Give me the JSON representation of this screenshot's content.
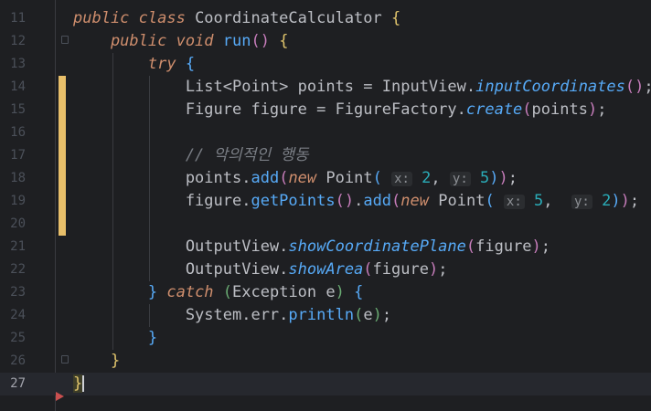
{
  "editor": {
    "lines": [
      {
        "n": "11",
        "parts": [
          [
            "kwi",
            "public class "
          ],
          [
            "cls",
            "CoordinateCalculator "
          ],
          [
            "brace-y",
            "{"
          ]
        ]
      },
      {
        "n": "12",
        "parts": [
          [
            "kwi",
            "    public void "
          ],
          [
            "mth",
            "run"
          ],
          [
            "paren-p",
            "() "
          ],
          [
            "brace-y",
            "{"
          ]
        ]
      },
      {
        "n": "13",
        "parts": [
          [
            "kwi",
            "        try "
          ],
          [
            "paren-b",
            "{"
          ]
        ]
      },
      {
        "n": "14",
        "parts": [
          [
            "cls",
            "            List<Point> points = InputView."
          ],
          [
            "fn-st",
            "inputCoordinates"
          ],
          [
            "paren-p",
            "()"
          ],
          [
            "cls",
            ";"
          ]
        ]
      },
      {
        "n": "15",
        "parts": [
          [
            "cls",
            "            Figure figure = FigureFactory."
          ],
          [
            "fn-st",
            "create"
          ],
          [
            "paren-p",
            "("
          ],
          [
            "cls",
            "points"
          ],
          [
            "paren-p",
            ")"
          ],
          [
            "cls",
            ";"
          ]
        ]
      },
      {
        "n": "16",
        "parts": []
      },
      {
        "n": "17",
        "parts": [
          [
            "cmt",
            "            // 악의적인 행동"
          ]
        ]
      },
      {
        "n": "18",
        "parts": [
          [
            "cls",
            "            points."
          ],
          [
            "mth",
            "add"
          ],
          [
            "paren-p",
            "("
          ],
          [
            "kwi",
            "new "
          ],
          [
            "cls",
            "Point"
          ],
          [
            "paren-b",
            "( "
          ],
          [
            "hint",
            "x:"
          ],
          [
            "cls",
            " "
          ],
          [
            "num",
            "2"
          ],
          [
            "cls",
            ", "
          ],
          [
            "hint",
            "y:"
          ],
          [
            "cls",
            " "
          ],
          [
            "num",
            "5"
          ],
          [
            "paren-b",
            ")"
          ],
          [
            "paren-p",
            ")"
          ],
          [
            "cls",
            ";"
          ]
        ]
      },
      {
        "n": "19",
        "parts": [
          [
            "cls",
            "            figure."
          ],
          [
            "mth",
            "getPoints"
          ],
          [
            "paren-p",
            "()"
          ],
          [
            "cls",
            "."
          ],
          [
            "mth",
            "add"
          ],
          [
            "paren-p",
            "("
          ],
          [
            "kwi",
            "new "
          ],
          [
            "cls",
            "Point"
          ],
          [
            "paren-b",
            "( "
          ],
          [
            "hint",
            "x:"
          ],
          [
            "cls",
            " "
          ],
          [
            "num",
            "5"
          ],
          [
            "cls",
            ",  "
          ],
          [
            "hint",
            "y:"
          ],
          [
            "cls",
            " "
          ],
          [
            "num",
            "2"
          ],
          [
            "paren-b",
            ")"
          ],
          [
            "paren-p",
            ")"
          ],
          [
            "cls",
            ";"
          ]
        ]
      },
      {
        "n": "20",
        "parts": []
      },
      {
        "n": "21",
        "parts": [
          [
            "cls",
            "            OutputView."
          ],
          [
            "fn-st",
            "showCoordinatePlane"
          ],
          [
            "paren-p",
            "("
          ],
          [
            "cls",
            "figure"
          ],
          [
            "paren-p",
            ")"
          ],
          [
            "cls",
            ";"
          ]
        ]
      },
      {
        "n": "22",
        "parts": [
          [
            "cls",
            "            OutputView."
          ],
          [
            "fn-st",
            "showArea"
          ],
          [
            "paren-p",
            "("
          ],
          [
            "cls",
            "figure"
          ],
          [
            "paren-p",
            ")"
          ],
          [
            "cls",
            ";"
          ]
        ]
      },
      {
        "n": "23",
        "parts": [
          [
            "paren-b",
            "        } "
          ],
          [
            "kwi",
            "catch "
          ],
          [
            "paren-g",
            "("
          ],
          [
            "cls",
            "Exception e"
          ],
          [
            "paren-g",
            ") "
          ],
          [
            "paren-b",
            "{"
          ]
        ]
      },
      {
        "n": "24",
        "parts": [
          [
            "cls",
            "            System.err."
          ],
          [
            "mth",
            "println"
          ],
          [
            "paren-g",
            "("
          ],
          [
            "cls",
            "e"
          ],
          [
            "paren-g",
            ")"
          ],
          [
            "cls",
            ";"
          ]
        ]
      },
      {
        "n": "25",
        "parts": [
          [
            "paren-b",
            "        }"
          ]
        ]
      },
      {
        "n": "26",
        "parts": [
          [
            "brace-y",
            "    }"
          ]
        ]
      },
      {
        "n": "27",
        "parts": [
          [
            "ret-brace",
            "}"
          ]
        ]
      }
    ]
  }
}
